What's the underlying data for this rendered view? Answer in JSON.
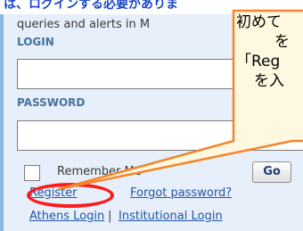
{
  "top_banner": {
    "text": "は、ログインする必要がありま"
  },
  "login_panel": {
    "intro_text": "queries and alerts in M",
    "login_label": "LOGIN",
    "login_value": "",
    "password_label": "PASSWORD",
    "password_value": "",
    "remember_label": "Remember Me",
    "remember_checked": false,
    "go_label": "Go"
  },
  "links": {
    "register": "Register",
    "forgot_password": "Forgot password?",
    "athens_login": "Athens Login",
    "separator": "|",
    "institutional_login": "Institutional Login"
  },
  "callout": {
    "line1": "初めて",
    "line2": "を",
    "line3": "「Reg",
    "line4": "を入"
  },
  "colors": {
    "panel_bg": "#e7effa",
    "label_blue": "#47729c",
    "link_blue": "#2255a4",
    "callout_fill": "#fef8e0",
    "callout_border": "#f3862b",
    "highlight_red": "#ff1a1a"
  }
}
